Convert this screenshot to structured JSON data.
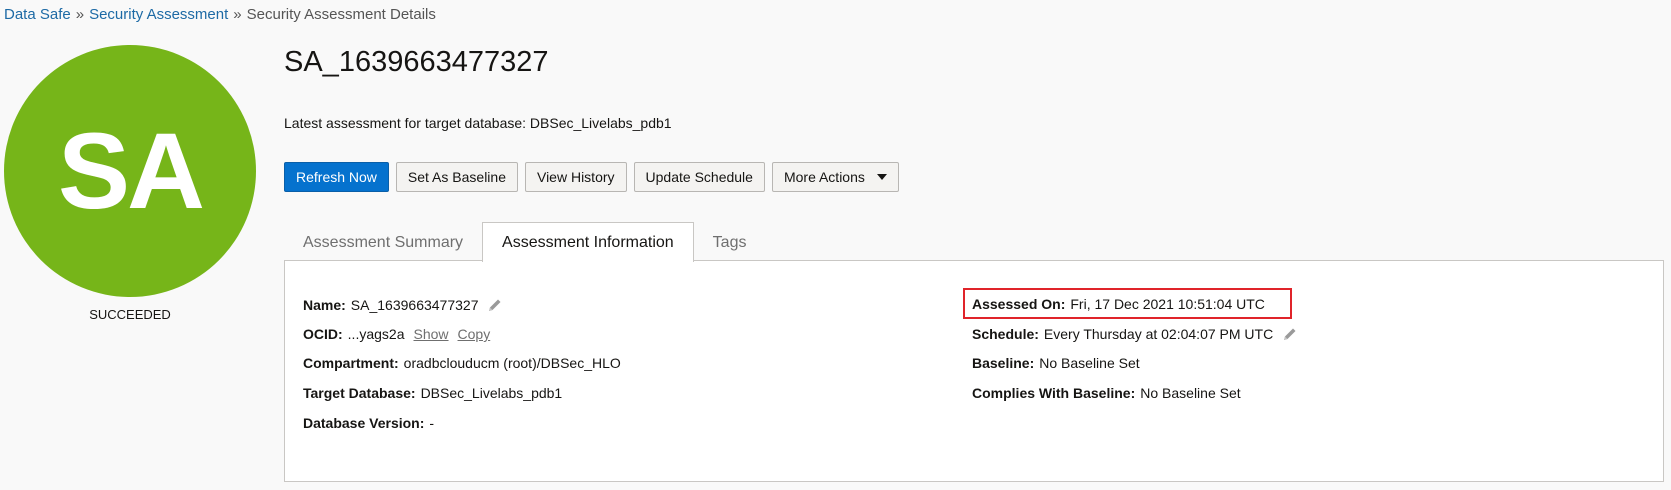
{
  "breadcrumb": {
    "items": [
      "Data Safe",
      "Security Assessment",
      "Security Assessment Details"
    ],
    "separator": "»"
  },
  "avatar": {
    "initials": "SA",
    "color": "#76b519"
  },
  "status": "SUCCEEDED",
  "header": {
    "title": "SA_1639663477327",
    "subtitle": "Latest assessment for target database: DBSec_Livelabs_pdb1"
  },
  "actions": {
    "refresh": "Refresh Now",
    "baseline": "Set As Baseline",
    "history": "View History",
    "schedule": "Update Schedule",
    "more": "More Actions"
  },
  "tabs": [
    "Assessment Summary",
    "Assessment Information",
    "Tags"
  ],
  "active_tab": "Assessment Information",
  "info": {
    "name": {
      "label": "Name:",
      "value": "SA_1639663477327"
    },
    "ocid": {
      "label": "OCID:",
      "value": "...yags2a",
      "show": "Show",
      "copy": "Copy"
    },
    "compartment": {
      "label": "Compartment:",
      "value": "oradbclouducm (root)/DBSec_HLO"
    },
    "target": {
      "label": "Target Database:",
      "value": "DBSec_Livelabs_pdb1"
    },
    "version": {
      "label": "Database Version:",
      "value": "-"
    },
    "assessed": {
      "label": "Assessed On:",
      "value": "Fri, 17 Dec 2021 10:51:04 UTC"
    },
    "schedule": {
      "label": "Schedule:",
      "value": "Every Thursday at 02:04:07 PM UTC"
    },
    "baseline": {
      "label": "Baseline:",
      "value": "No Baseline Set"
    },
    "complies": {
      "label": "Complies With Baseline:",
      "value": "No Baseline Set"
    }
  },
  "colors": {
    "primary_button": "#0572ce",
    "link": "#1d6aa5",
    "highlight_border": "#e0242a"
  }
}
